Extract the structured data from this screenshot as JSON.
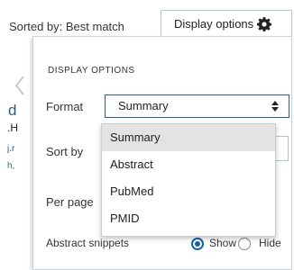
{
  "header": {
    "sorted_by": "Sorted by: Best match",
    "display_options_label": "Display options"
  },
  "panel": {
    "title": "DISPLAY OPTIONS",
    "format_label": "Format",
    "format_value": "Summary",
    "sort_by_label": "Sort by",
    "per_page_label": "Per page",
    "format_options": [
      "Summary",
      "Abstract",
      "PubMed",
      "PMID"
    ],
    "snippets_label": "Abstract snippets",
    "snippet_show": "Show",
    "snippet_hide": "Hide"
  },
  "background": {
    "frag_d": "d",
    "frag_h": ".H",
    "frag_j": "j.r",
    "frag_h2": "h,"
  },
  "colors": {
    "accent": "#1462a8",
    "border": "#c6d3dc"
  }
}
